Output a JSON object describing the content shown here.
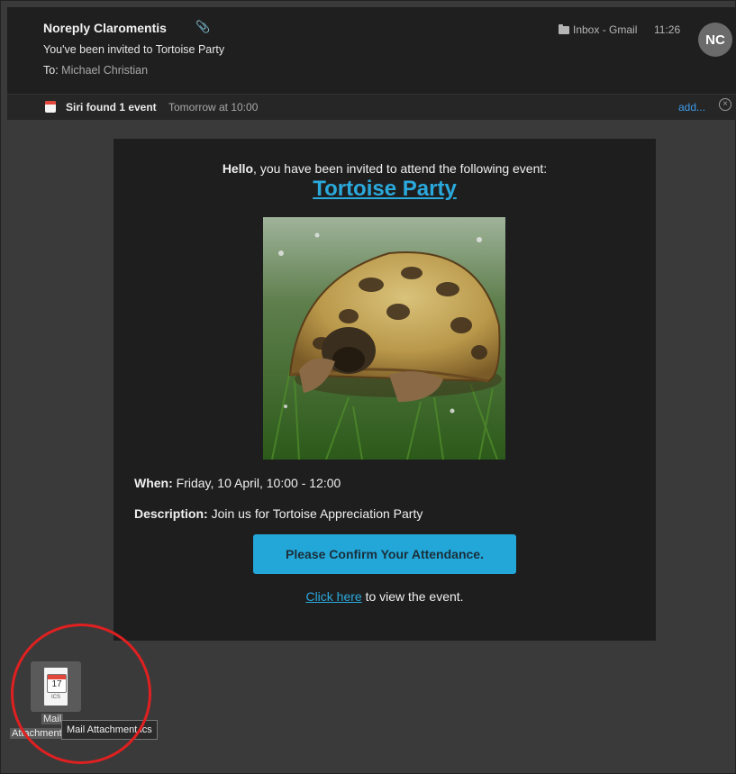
{
  "header": {
    "from": "Noreply Claromentis",
    "subject": "You've been invited to Tortoise Party",
    "to_label": "To:",
    "to_name": "Michael Christian",
    "folder": "Inbox - Gmail",
    "time": "11:26",
    "avatar_initials": "NC"
  },
  "siri": {
    "label": "Siri found 1 event",
    "when": "Tomorrow at 10:00",
    "add": "add..."
  },
  "email": {
    "hello": "Hello",
    "intro_rest": ", you have been invited to attend the following event:",
    "event_title": "Tortoise Party",
    "when_label": "When:",
    "when_value": " Friday, 10 April, 10:00 - 12:00",
    "desc_label": "Description:",
    "desc_value": " Join us for Tortoise Appreciation Party",
    "confirm_button": "Please Confirm Your Attendance.",
    "click_here": "Click here",
    "view_rest": " to view the event."
  },
  "attachment": {
    "icon_day": "17",
    "icon_ext": "ICS",
    "label_line1": "Mail",
    "label_line2": "Attachment.ics",
    "tooltip": "Mail Attachment.ics"
  },
  "colors": {
    "accent": "#2aa9dd",
    "button": "#23a7d9",
    "annotation_circle": "#e02020"
  }
}
